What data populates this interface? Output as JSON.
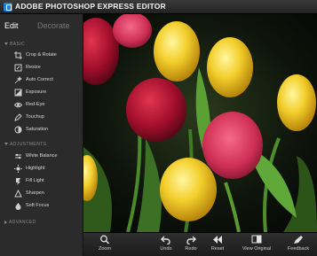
{
  "app": {
    "title": "ADOBE PHOTOSHOP EXPRESS EDITOR"
  },
  "tabs": {
    "edit": "Edit",
    "decorate": "Decorate"
  },
  "sections": {
    "basic": "BASIC",
    "adjustments": "ADJUSTMENTS",
    "advanced": "ADVANCED"
  },
  "basic_tools": [
    {
      "label": "Crop & Rotate",
      "icon": "crop-icon"
    },
    {
      "label": "Resize",
      "icon": "resize-icon"
    },
    {
      "label": "Auto Correct",
      "icon": "auto-correct-icon"
    },
    {
      "label": "Exposure",
      "icon": "exposure-icon"
    },
    {
      "label": "Red-Eye",
      "icon": "eye-icon"
    },
    {
      "label": "Touchup",
      "icon": "touchup-icon"
    },
    {
      "label": "Saturation",
      "icon": "saturation-icon"
    }
  ],
  "adjustment_tools": [
    {
      "label": "White Balance",
      "icon": "white-balance-icon"
    },
    {
      "label": "Highlight",
      "icon": "highlight-icon"
    },
    {
      "label": "Fill Light",
      "icon": "fill-light-icon"
    },
    {
      "label": "Sharpen",
      "icon": "sharpen-icon"
    },
    {
      "label": "Soft Focus",
      "icon": "soft-focus-icon"
    }
  ],
  "toolbar": {
    "zoom": "Zoom",
    "undo": "Undo",
    "redo": "Redo",
    "reset": "Reset",
    "view_original": "View Original",
    "feedback": "Feedback"
  },
  "colors": {
    "accent": "#2a7fd1",
    "sidebar_bg": "#2b2b2b",
    "toolbar_bg": "#232323"
  }
}
